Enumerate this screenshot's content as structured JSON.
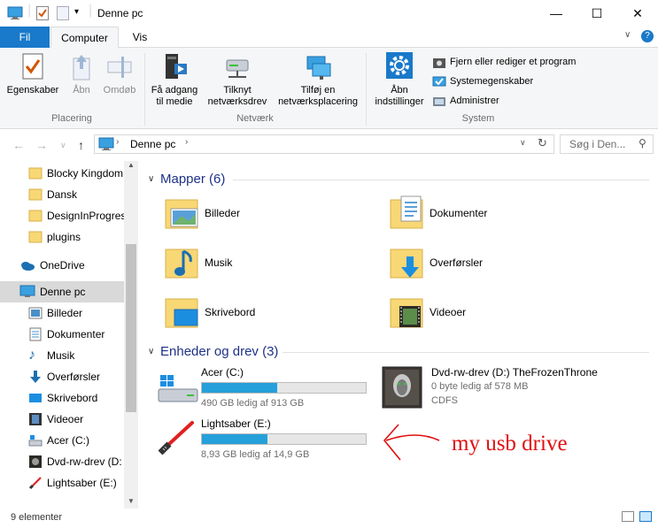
{
  "window": {
    "title": "Denne pc",
    "minimize": "—",
    "maximize": "☐",
    "close": "✕"
  },
  "tabs": {
    "file": "Fil",
    "computer": "Computer",
    "view": "Vis"
  },
  "ribbon": {
    "placering": {
      "label": "Placering",
      "properties": "Egenskaber",
      "open": "Åbn",
      "rename": "Omdøb"
    },
    "netvaerk": {
      "label": "Netværk",
      "media_line1": "Få adgang",
      "media_line2": "til medie",
      "map_line1": "Tilknyt",
      "map_line2": "netværksdrev",
      "add_line1": "Tilføj en",
      "add_line2": "netværksplacering"
    },
    "system": {
      "label": "System",
      "settings_line1": "Åbn",
      "settings_line2": "indstillinger",
      "uninstall": "Fjern eller rediger et program",
      "sysprops": "Systemegenskaber",
      "manage": "Administrer"
    }
  },
  "address": {
    "path": "Denne pc",
    "search_placeholder": "Søg i Den..."
  },
  "nav": {
    "items": [
      {
        "label": "Blocky Kingdom",
        "icon": "folder-icon"
      },
      {
        "label": "Dansk",
        "icon": "folder-icon"
      },
      {
        "label": "DesignInProgres",
        "icon": "folder-icon"
      },
      {
        "label": "plugins",
        "icon": "folder-icon"
      },
      {
        "label": "OneDrive",
        "icon": "onedrive-icon"
      },
      {
        "label": "Denne pc",
        "icon": "computer-icon"
      },
      {
        "label": "Billeder",
        "icon": "pictures-icon"
      },
      {
        "label": "Dokumenter",
        "icon": "documents-icon"
      },
      {
        "label": "Musik",
        "icon": "music-icon"
      },
      {
        "label": "Overførsler",
        "icon": "downloads-icon"
      },
      {
        "label": "Skrivebord",
        "icon": "desktop-icon"
      },
      {
        "label": "Videoer",
        "icon": "videos-icon"
      },
      {
        "label": "Acer (C:)",
        "icon": "drive-icon"
      },
      {
        "label": "Dvd-rw-drev (D:",
        "icon": "dvd-icon"
      },
      {
        "label": "Lightsaber (E:)",
        "icon": "usb-icon"
      }
    ]
  },
  "folders": {
    "heading": "Mapper (6)",
    "items": [
      {
        "label": "Billeder"
      },
      {
        "label": "Dokumenter"
      },
      {
        "label": "Musik"
      },
      {
        "label": "Overførsler"
      },
      {
        "label": "Skrivebord"
      },
      {
        "label": "Videoer"
      }
    ]
  },
  "drives": {
    "heading": "Enheder og drev (3)",
    "items": [
      {
        "label": "Acer (C:)",
        "free": "490 GB ledig af 913 GB",
        "used_fraction": 0.46
      },
      {
        "label": "Dvd-rw-drev (D:) TheFrozenThrone",
        "free": "0 byte ledig af 578 MB",
        "fs": "CDFS"
      },
      {
        "label": "Lightsaber (E:)",
        "free": "8,93 GB ledig af 14,9 GB",
        "used_fraction": 0.4
      }
    ]
  },
  "annotation": "my usb drive",
  "status": {
    "count": "9 elementer"
  },
  "colors": {
    "accent": "#1979ca",
    "progress": "#26a0da",
    "heading": "#1e3287",
    "annotation": "#e01010"
  }
}
